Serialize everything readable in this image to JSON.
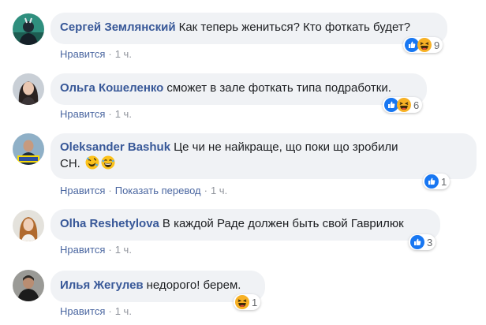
{
  "comments": [
    {
      "author": "Сергей Землянский",
      "text": "Как теперь жениться? Кто фоткать будет?",
      "actions": [
        "Нравится"
      ],
      "time": "1 ч.",
      "reaction_icons": [
        "like-icon",
        "haha-icon"
      ],
      "reaction_count": "9"
    },
    {
      "author": "Ольга Кошеленко",
      "text": "сможет в зале фоткать типа подработки.",
      "actions": [
        "Нравится"
      ],
      "time": "1 ч.",
      "reaction_icons": [
        "like-icon",
        "haha-icon"
      ],
      "reaction_count": "6"
    },
    {
      "author": "Oleksander Bashuk",
      "text_line1": "Це чи не найкраще, що поки що зробили",
      "text_line2": "СН.",
      "inline_emojis": [
        "rofl-emoji",
        "grin-emoji"
      ],
      "actions": [
        "Нравится",
        "Показать перевод"
      ],
      "time": "1 ч.",
      "reaction_icons": [
        "like-icon"
      ],
      "reaction_count": "1"
    },
    {
      "author": "Olha Reshetylova",
      "text": "В каждой Раде должен быть свой Гаврилюк",
      "actions": [
        "Нравится"
      ],
      "time": "1 ч.",
      "reaction_icons": [
        "like-icon"
      ],
      "reaction_count": "3"
    },
    {
      "author": "Илья Жегулев",
      "text": "недорого! берем.",
      "actions": [
        "Нравится"
      ],
      "time": "1 ч.",
      "reaction_icons": [
        "haha-icon"
      ],
      "reaction_count": "1"
    }
  ],
  "separator": "·",
  "colors": {
    "bubble_bg": "#f0f2f5",
    "author": "#385898",
    "link": "#4b67a1",
    "meta": "#90949c",
    "like_blue": "#1877f2",
    "haha_yellow": "#f7b125"
  }
}
